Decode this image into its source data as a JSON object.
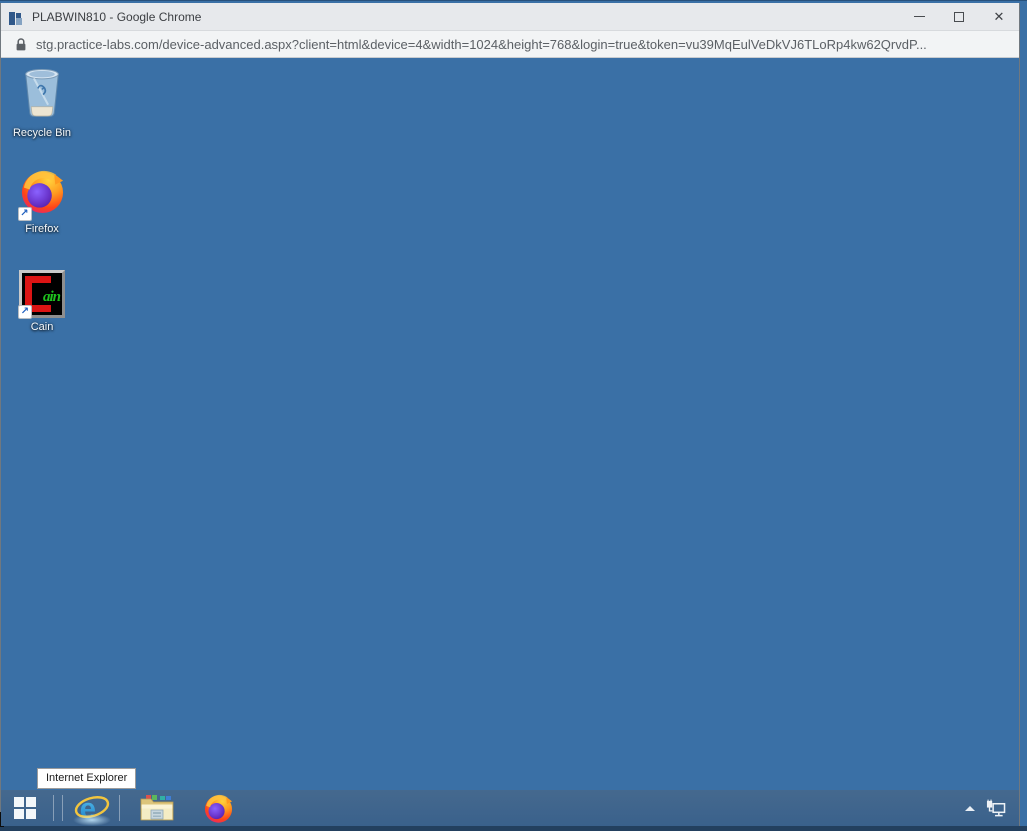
{
  "window": {
    "title": "PLABWIN810 - Google Chrome",
    "app_icon": "practice-labs-logo-icon",
    "controls": {
      "minimize_icon": "minimize-icon",
      "maximize_icon": "maximize-icon",
      "close_icon": "close-icon",
      "close_glyph": "✕"
    }
  },
  "address_bar": {
    "security_icon": "lock-icon",
    "url": "stg.practice-labs.com/device-advanced.aspx?client=html&device=4&width=1024&height=768&login=true&token=vu39MqEulVeDkVJ6TLoRp4kw62QrvdP..."
  },
  "remote_desktop": {
    "icons": [
      {
        "id": "recycle-bin",
        "label": "Recycle Bin",
        "shortcut": false
      },
      {
        "id": "firefox",
        "label": "Firefox",
        "shortcut": true
      },
      {
        "id": "cain",
        "label": "Cain",
        "shortcut": true
      }
    ],
    "shortcut_arrow_glyph": "↗",
    "tooltip": "Internet Explorer",
    "taskbar": {
      "buttons": [
        {
          "id": "start",
          "icon": "windows-start-icon"
        },
        {
          "id": "internet-explorer",
          "icon": "internet-explorer-icon"
        },
        {
          "id": "file-explorer",
          "icon": "folder-icon"
        },
        {
          "id": "firefox",
          "icon": "firefox-icon"
        }
      ],
      "tray": [
        {
          "id": "show-hidden-icons",
          "icon": "chevron-up-icon"
        },
        {
          "id": "network",
          "icon": "network-ethernet-icon"
        }
      ]
    }
  },
  "colors": {
    "desktop_background": "#3a70a6",
    "taskbar_background": "#3e648e",
    "titlebar_background": "#e7e9ec",
    "urlbar_background": "#f2f4f5",
    "url_text": "#5b6065",
    "tooltip_background": "#ffffff",
    "host_bottom_strip": "#23405f"
  }
}
